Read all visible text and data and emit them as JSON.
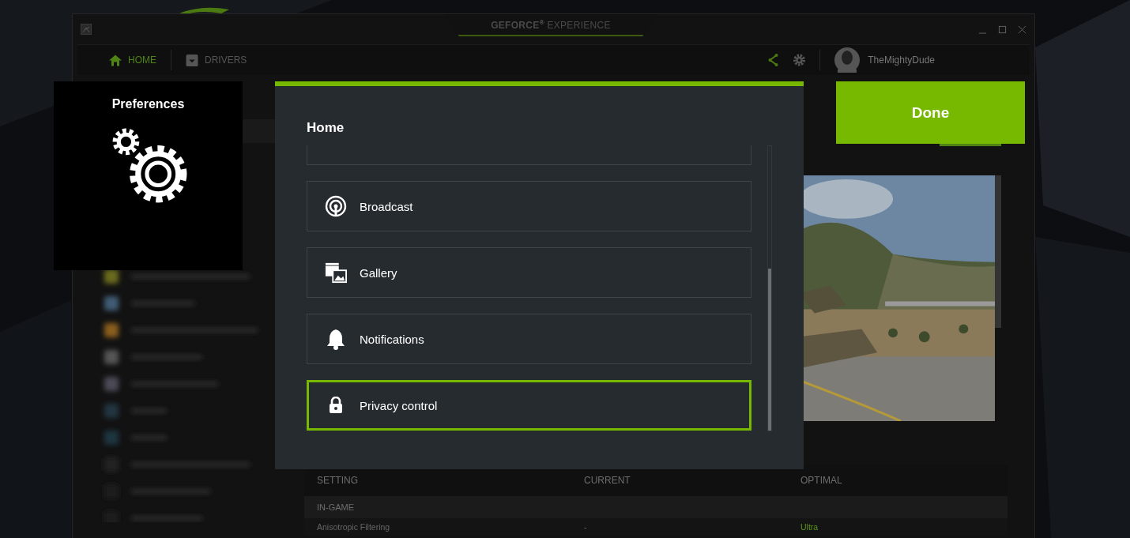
{
  "window": {
    "title": "**GEFORCE**$^{®}$ EXPERIENCE"
  },
  "nav": [
    {
      "label": "HOME",
      "selected": true
    },
    {
      "label": "DRIVERS",
      "selected": false
    }
  ],
  "user": {
    "name": "TheMightyDude"
  },
  "preferences": {
    "title": "Preferences"
  },
  "panel": {
    "title": "Home",
    "items": [
      {
        "label": "Broadcast",
        "selected": false
      },
      {
        "label": "Gallery",
        "selected": false
      },
      {
        "label": "Notifications",
        "selected": false
      },
      {
        "label": "Privacy control",
        "selected": true
      }
    ]
  },
  "done_button": {
    "label": "Done"
  },
  "table": {
    "columns": [
      "SETTING",
      "CURRENT",
      "OPTIMAL"
    ],
    "rows": [
      {
        "kind": "section",
        "label": "IN-GAME"
      },
      {
        "kind": "setting",
        "setting": "Anisotropic Filtering",
        "current": "-",
        "optimal": "Ultra"
      }
    ]
  }
}
